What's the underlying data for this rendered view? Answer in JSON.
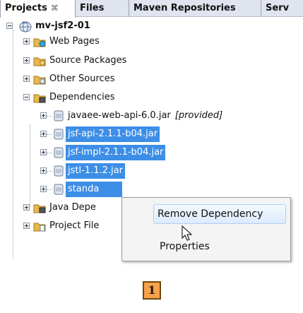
{
  "tabs": [
    {
      "label": "Projects",
      "close": "⌘"
    },
    {
      "label": "Files"
    },
    {
      "label": "Maven Repositories"
    },
    {
      "label": "Serv"
    }
  ],
  "tree": {
    "root": "mv-jsf2-01",
    "web_pages": "Web Pages",
    "source_packages": "Source Packages",
    "other_sources": "Other Sources",
    "dependencies": "Dependencies",
    "deps": [
      {
        "name": "javaee-web-api-6.0.jar",
        "tag": "[provided]"
      },
      {
        "name": "jsf-api-2.1.1-b04.jar"
      },
      {
        "name": "jsf-impl-2.1.1-b04.jar"
      },
      {
        "name": "jstl-1.1.2.jar"
      },
      {
        "name": "standa"
      }
    ],
    "java_deps": "Java Depe",
    "project_files": "Project File"
  },
  "context_menu": {
    "items": [
      "Remove Dependency",
      "Properties"
    ]
  },
  "badge": "1",
  "icons": {
    "expander": "plus-box",
    "root": "maven-project-icon",
    "folder": "folder-icon",
    "jar": "jar-icon"
  },
  "colors": {
    "selection": "#3d8ee6",
    "badge": "#f7a24a"
  }
}
